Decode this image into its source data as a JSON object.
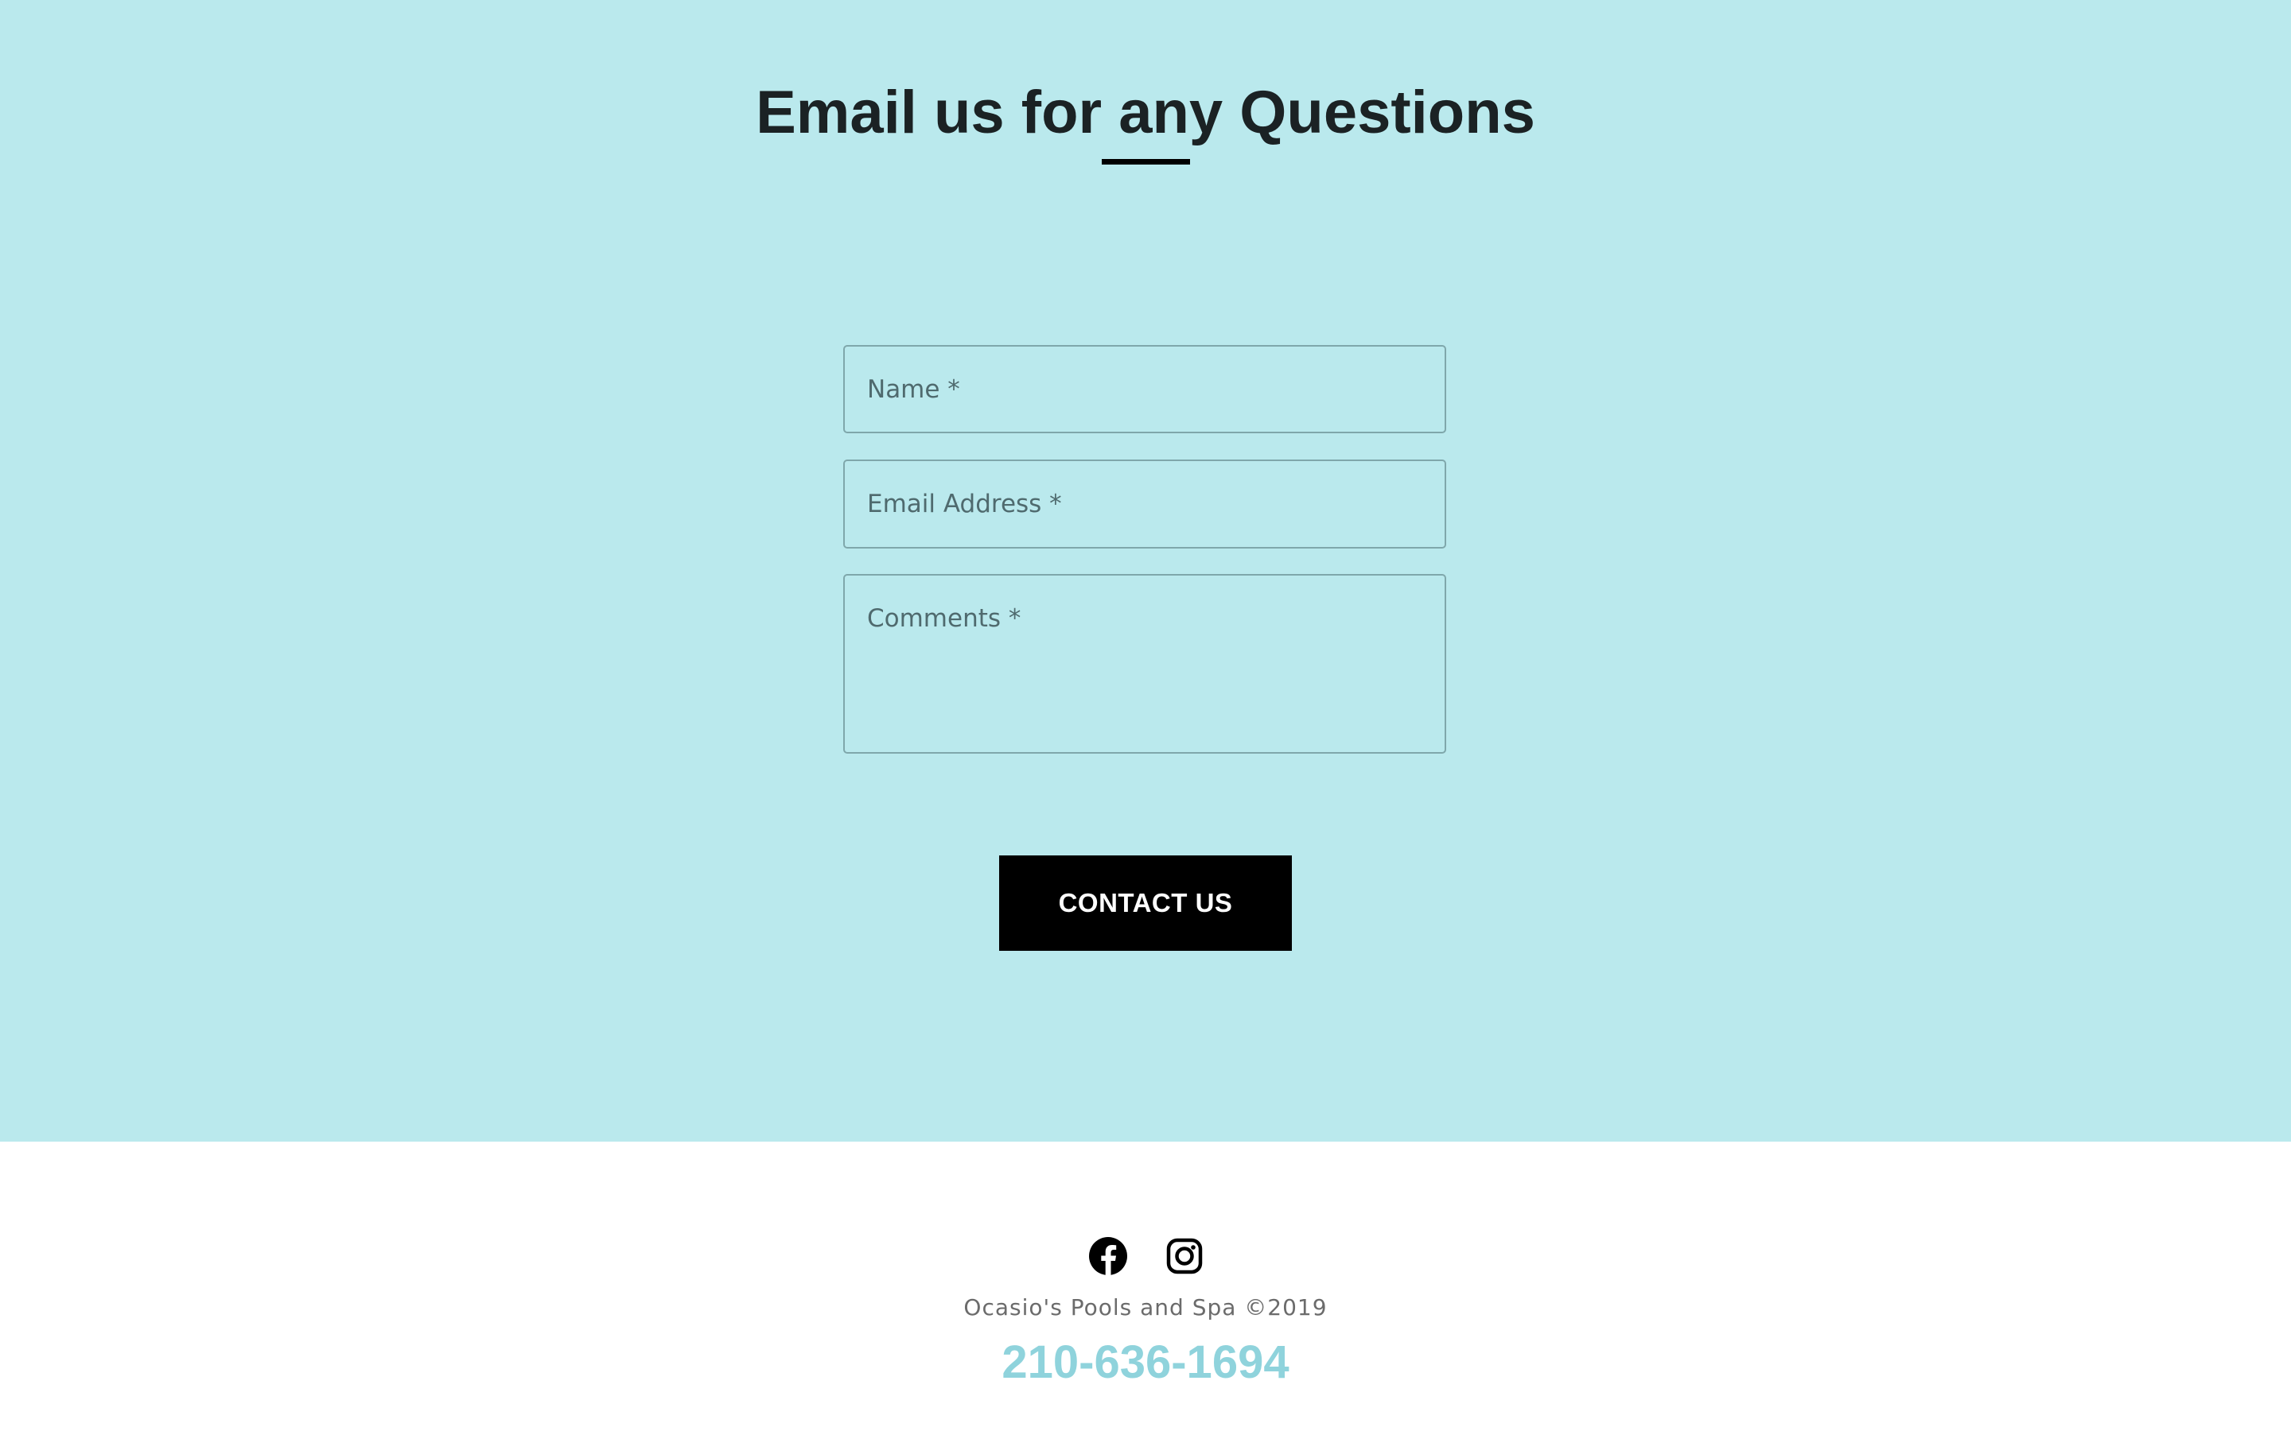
{
  "contact": {
    "heading": "Email us for any Questions",
    "form": {
      "name_placeholder": "Name *",
      "email_placeholder": "Email Address *",
      "comments_placeholder": "Comments *",
      "submit_label": "CONTACT US"
    }
  },
  "footer": {
    "social": {
      "facebook_icon": "facebook-icon",
      "instagram_icon": "instagram-icon"
    },
    "copyright": "Ocasio's Pools and Spa ©2019",
    "phone": "210-636-1694"
  },
  "colors": {
    "section_background": "#bae9ed",
    "button_background": "#000000",
    "phone_accent": "#8fd3dc"
  }
}
